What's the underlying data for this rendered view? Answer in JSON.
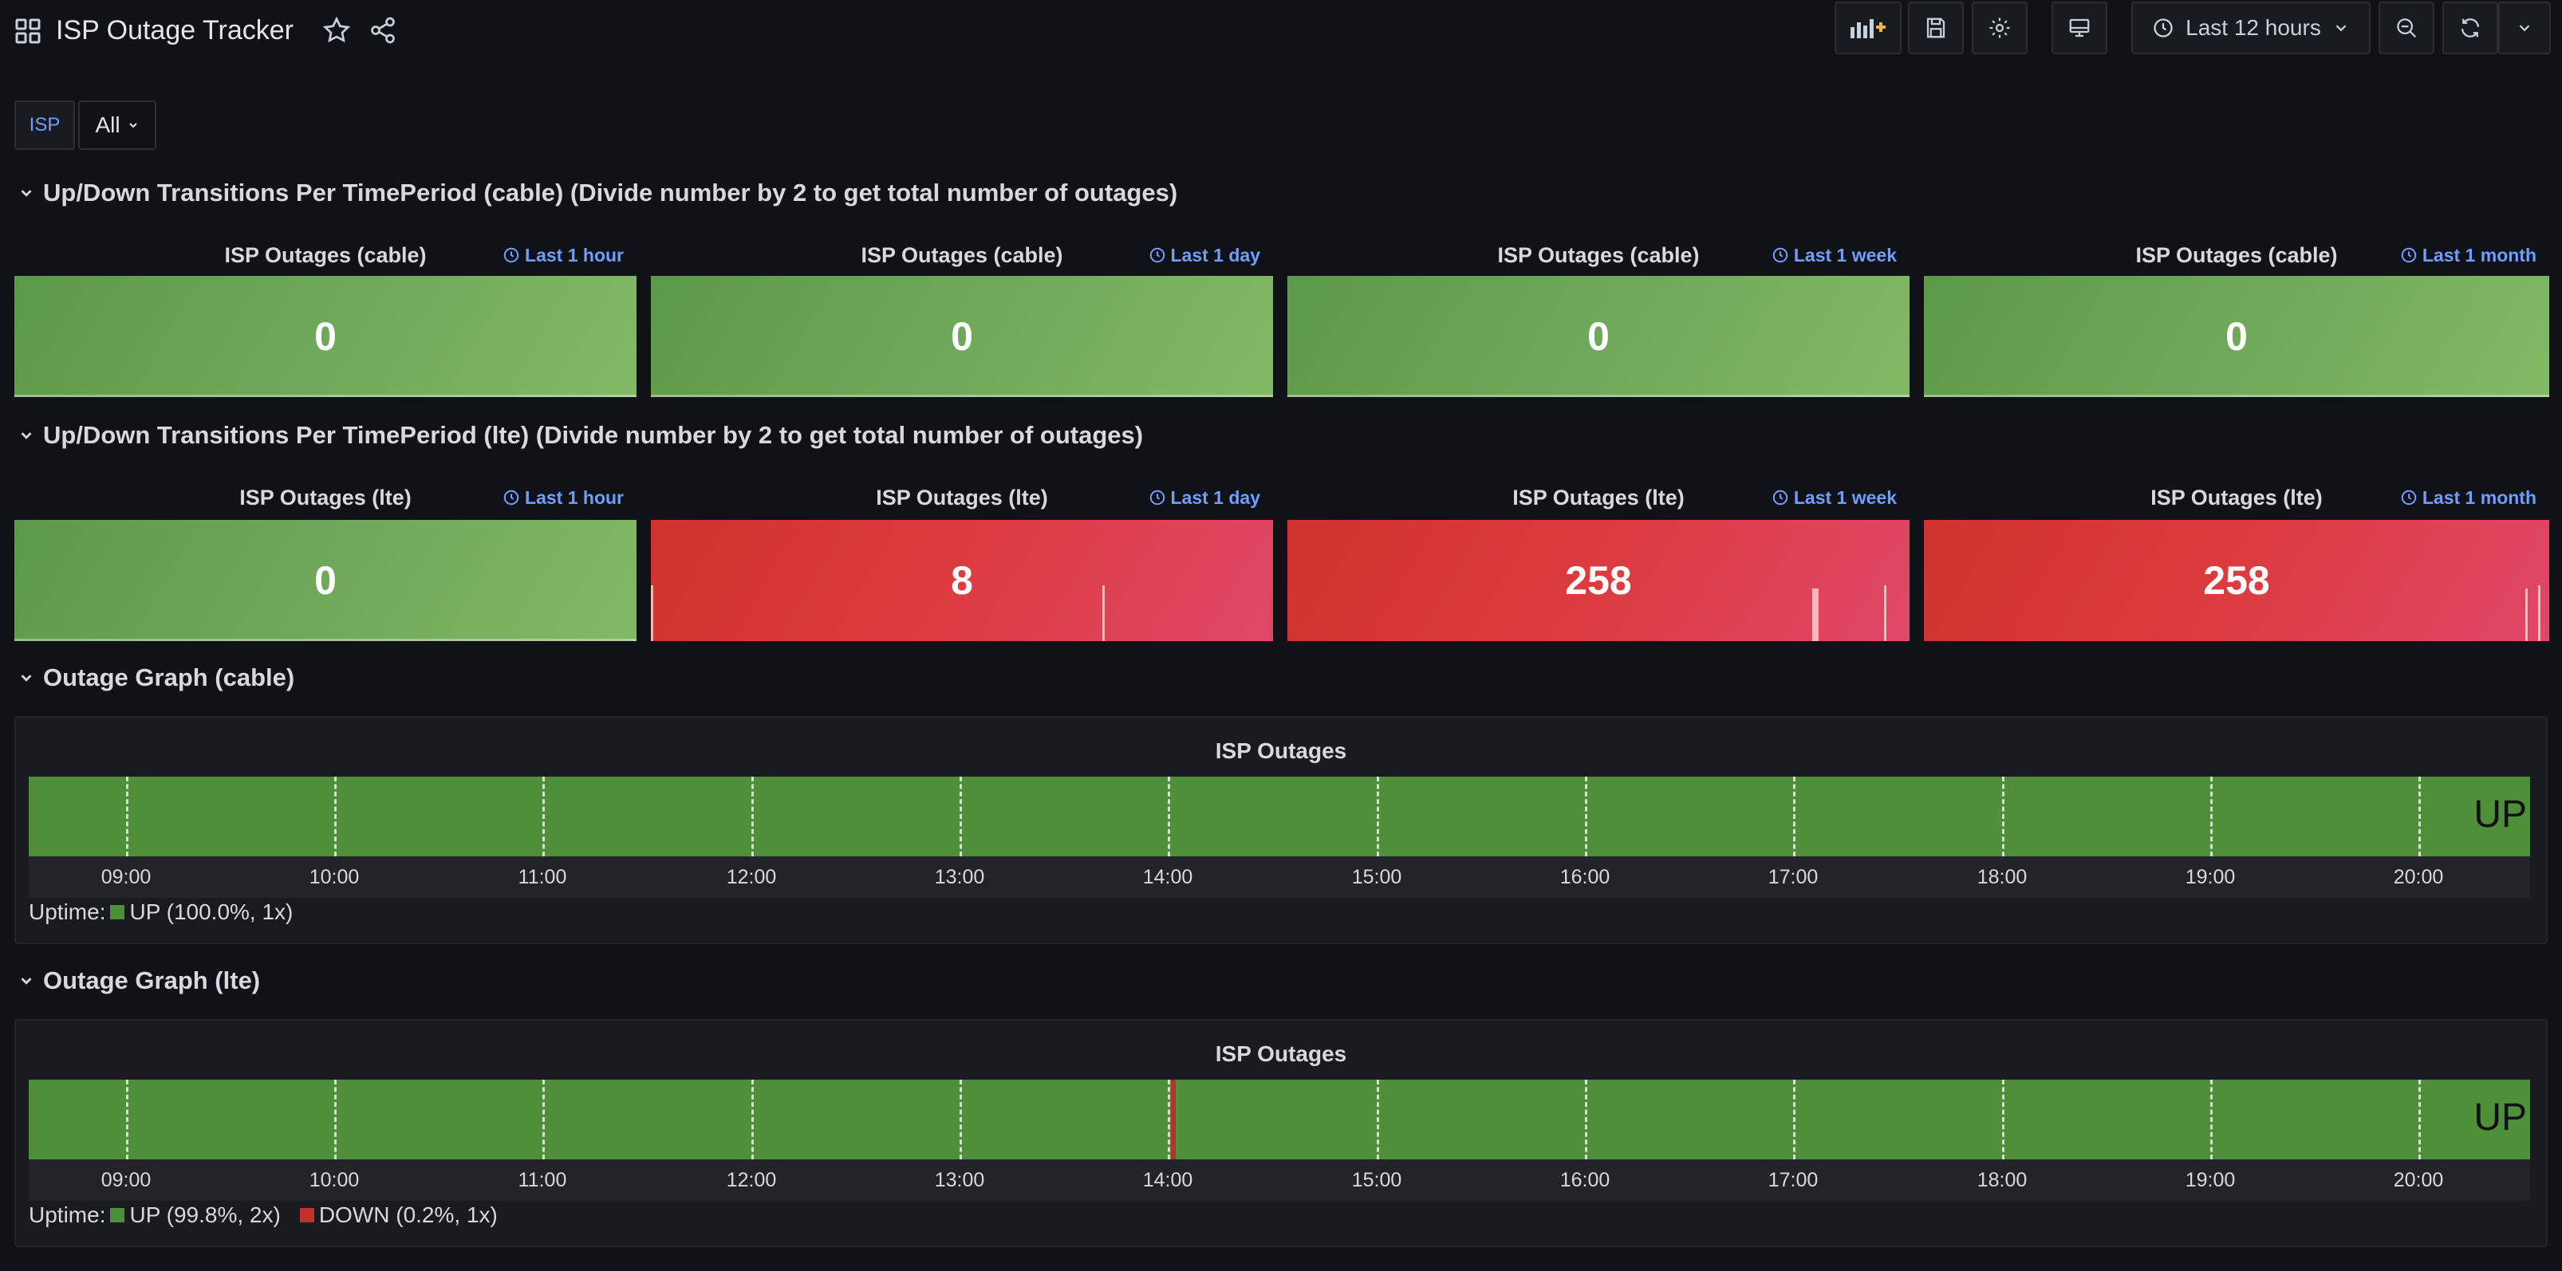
{
  "header": {
    "title": "ISP Outage Tracker",
    "time_range": "Last 12 hours"
  },
  "icons": [
    "grid-icon",
    "star-icon",
    "share-icon",
    "add-panel-icon",
    "save-icon",
    "gear-icon",
    "tv-icon",
    "clock-icon",
    "chevron-down-icon",
    "zoom-out-icon",
    "refresh-icon"
  ],
  "variables": {
    "label": "ISP",
    "value": "All"
  },
  "rows": [
    {
      "title": "Up/Down Transitions Per TimePeriod (cable) (Divide number by 2 to get total number of outages)",
      "panels": [
        {
          "title": "ISP Outages (cable)",
          "time": "Last 1 hour",
          "value": "0",
          "status": "green"
        },
        {
          "title": "ISP Outages (cable)",
          "time": "Last 1 day",
          "value": "0",
          "status": "green"
        },
        {
          "title": "ISP Outages (cable)",
          "time": "Last 1 week",
          "value": "0",
          "status": "green"
        },
        {
          "title": "ISP Outages (cable)",
          "time": "Last 1 month",
          "value": "0",
          "status": "green"
        }
      ]
    },
    {
      "title": "Up/Down Transitions Per TimePeriod (lte) (Divide number by 2 to get total number of outages)",
      "panels": [
        {
          "title": "ISP Outages (lte)",
          "time": "Last 1 hour",
          "value": "0",
          "status": "green"
        },
        {
          "title": "ISP Outages (lte)",
          "time": "Last 1 day",
          "value": "8",
          "status": "red"
        },
        {
          "title": "ISP Outages (lte)",
          "time": "Last 1 week",
          "value": "258",
          "status": "red"
        },
        {
          "title": "ISP Outages (lte)",
          "time": "Last 1 month",
          "value": "258",
          "status": "red"
        }
      ]
    }
  ],
  "graphs": [
    {
      "row_title": "Outage Graph (cable)",
      "panel_title": "ISP Outages",
      "state_label": "UP",
      "x_ticks": [
        "09:00",
        "10:00",
        "11:00",
        "12:00",
        "13:00",
        "14:00",
        "15:00",
        "16:00",
        "17:00",
        "18:00",
        "19:00",
        "20:00"
      ],
      "legend_prefix": "Uptime:",
      "legend": [
        {
          "label": "UP (100.0%, 1x)",
          "color": "#4f8f3a"
        }
      ]
    },
    {
      "row_title": "Outage Graph (lte)",
      "panel_title": "ISP Outages",
      "state_label": "UP",
      "x_ticks": [
        "09:00",
        "10:00",
        "11:00",
        "12:00",
        "13:00",
        "14:00",
        "15:00",
        "16:00",
        "17:00",
        "18:00",
        "19:00",
        "20:00"
      ],
      "legend_prefix": "Uptime:",
      "legend": [
        {
          "label": "UP (99.8%, 2x)",
          "color": "#4f8f3a"
        },
        {
          "label": "DOWN (0.2%, 1x)",
          "color": "#c4302b"
        }
      ]
    }
  ],
  "colors": {
    "background": "#111217",
    "accent": "#6e9fff",
    "up": "#4f8f3a",
    "down": "#c4302b"
  }
}
